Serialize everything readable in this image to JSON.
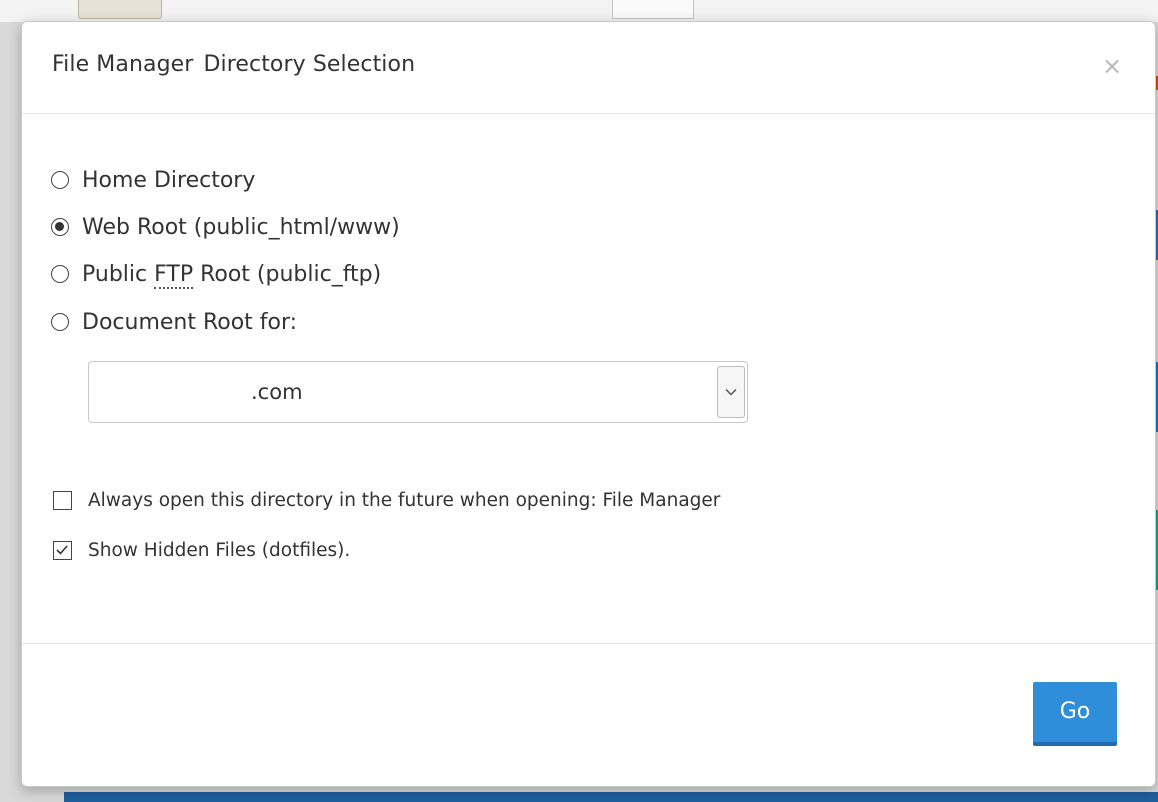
{
  "modal": {
    "title_part1": "File Manager",
    "title_part2": "Directory Selection",
    "close_glyph": "×"
  },
  "directory_options": {
    "home": {
      "label": "Home Directory",
      "selected": false
    },
    "web_root": {
      "label": "Web Root (public_html/www)",
      "selected": true
    },
    "public_ftp": {
      "label_prefix": "Public ",
      "abbr": "FTP",
      "label_suffix": " Root (public_ftp)",
      "selected": false
    },
    "document_root": {
      "label": "Document Root for:",
      "selected": false
    }
  },
  "domain_select": {
    "value": ".com",
    "arrow_icon": "chevron-down-icon"
  },
  "options": {
    "always_open": {
      "label": "Always open this directory in the future when opening: File Manager",
      "checked": false
    },
    "show_hidden": {
      "label": "Show Hidden Files (dotfiles).",
      "checked": true
    }
  },
  "footer": {
    "go_label": "Go",
    "go_color": "#2f8dd9"
  }
}
